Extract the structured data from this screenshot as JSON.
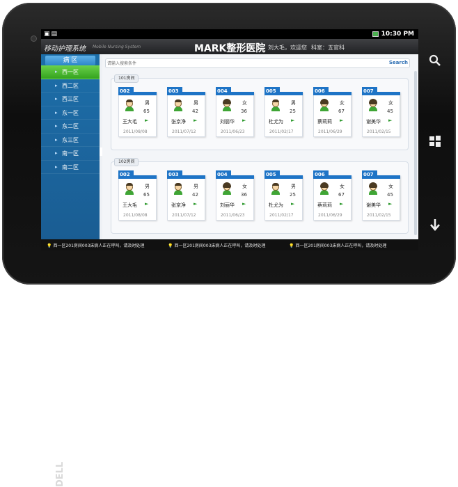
{
  "device": {
    "brand": "DELL"
  },
  "statusbar": {
    "time": "10:30 PM"
  },
  "app": {
    "title": "移动护理系统",
    "subtitle": "Mobile Nursing System",
    "hospital": "MARK整形医院",
    "welcome": "刘大毛，欢迎您",
    "department": "科室：五官科"
  },
  "sidebar": {
    "header": "病 区",
    "items": [
      {
        "label": "西一区",
        "active": true
      },
      {
        "label": "西二区"
      },
      {
        "label": "西三区"
      },
      {
        "label": "东一区"
      },
      {
        "label": "东二区"
      },
      {
        "label": "东三区"
      },
      {
        "label": "南一区"
      },
      {
        "label": "南二区"
      }
    ]
  },
  "search": {
    "placeholder": "请输入搜索条件",
    "button": "Search"
  },
  "rooms": [
    {
      "label": "101房间",
      "patients": [
        {
          "bed": "002",
          "gender": "男",
          "age": "65",
          "name": "王大毛",
          "date": "2011/08/08",
          "avatar": "m"
        },
        {
          "bed": "003",
          "gender": "男",
          "age": "42",
          "name": "张京净",
          "date": "2011/07/12",
          "avatar": "m"
        },
        {
          "bed": "004",
          "gender": "女",
          "age": "36",
          "name": "刘丽华",
          "date": "2011/06/23",
          "avatar": "f"
        },
        {
          "bed": "005",
          "gender": "男",
          "age": "25",
          "name": "杜尤为",
          "date": "2011/02/17",
          "avatar": "m"
        },
        {
          "bed": "006",
          "gender": "女",
          "age": "67",
          "name": "蔡莉莉",
          "date": "2011/06/29",
          "avatar": "f"
        },
        {
          "bed": "007",
          "gender": "女",
          "age": "45",
          "name": "谢美华",
          "date": "2011/02/15",
          "avatar": "f"
        }
      ]
    },
    {
      "label": "102房间",
      "patients": [
        {
          "bed": "002",
          "gender": "男",
          "age": "65",
          "name": "王大毛",
          "date": "2011/08/08",
          "avatar": "m"
        },
        {
          "bed": "003",
          "gender": "男",
          "age": "42",
          "name": "张京净",
          "date": "2011/07/12",
          "avatar": "m"
        },
        {
          "bed": "004",
          "gender": "女",
          "age": "36",
          "name": "刘丽华",
          "date": "2011/06/23",
          "avatar": "f"
        },
        {
          "bed": "005",
          "gender": "男",
          "age": "25",
          "name": "杜尤为",
          "date": "2011/02/17",
          "avatar": "m"
        },
        {
          "bed": "006",
          "gender": "女",
          "age": "67",
          "name": "蔡莉莉",
          "date": "2011/06/29",
          "avatar": "f"
        },
        {
          "bed": "007",
          "gender": "女",
          "age": "45",
          "name": "谢美华",
          "date": "2011/02/15",
          "avatar": "f"
        }
      ]
    }
  ],
  "ticker": [
    "西一区201房间003床病人正在呼叫，请及时处理",
    "西一区201房间003床病人正在呼叫，请及时处理",
    "西一区201房间003床病人正在呼叫，请及时处理"
  ]
}
